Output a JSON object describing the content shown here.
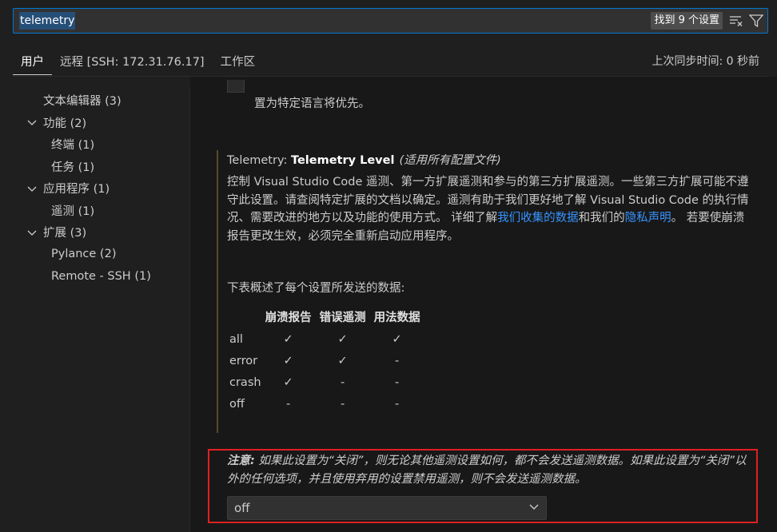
{
  "search": {
    "query": "telemetry",
    "result_count": "找到 9 个设置",
    "icons": [
      "clear-filter-icon",
      "filter-icon"
    ]
  },
  "tabs": [
    {
      "label": "用户",
      "active": true
    },
    {
      "label": "远程 [SSH: 172.31.76.17]",
      "active": false
    },
    {
      "label": "工作区",
      "active": false
    }
  ],
  "sync_status": "上次同步时间: 0 秒前",
  "toc": [
    {
      "label": "文本编辑器 (3)",
      "level": 0,
      "expandable": false
    },
    {
      "label": "功能 (2)",
      "level": 0,
      "expandable": true
    },
    {
      "label": "终端 (1)",
      "level": 1,
      "expandable": false
    },
    {
      "label": "任务 (1)",
      "level": 1,
      "expandable": false
    },
    {
      "label": "应用程序 (1)",
      "level": 0,
      "expandable": true
    },
    {
      "label": "遥测 (1)",
      "level": 1,
      "expandable": false
    },
    {
      "label": "扩展 (3)",
      "level": 0,
      "expandable": true
    },
    {
      "label": "Pylance (2)",
      "level": 1,
      "expandable": false
    },
    {
      "label": "Remote - SSH (1)",
      "level": 1,
      "expandable": false
    }
  ],
  "prev_setting_tail": "置为特定语言将优先。",
  "setting": {
    "category": "Telemetry: ",
    "name": "Telemetry Level",
    "scope": "(适用所有配置文件)",
    "desc_part1": "控制 Visual Studio Code 遥测、第一方扩展遥测和参与的第三方扩展遥测。一些第三方扩展可能不遵守此设置。请查阅特定扩展的文档以确定。遥测有助于我们更好地了解 Visual Studio Code 的执行情况、需要改进的地方以及功能的使用方式。 详细了解",
    "link1": "我们收集的数据",
    "desc_part2": "和我们的",
    "link2": "隐私声明",
    "desc_part3": "。 若要使崩溃报告更改生效，必须完全重新启动应用程序。",
    "overview": "下表概述了每个设置所发送的数据:",
    "table": {
      "headers": [
        "",
        "崩溃报告",
        "错误遥测",
        "用法数据"
      ],
      "rows": [
        [
          "all",
          "✓",
          "✓",
          "✓"
        ],
        [
          "error",
          "✓",
          "✓",
          "-"
        ],
        [
          "crash",
          "✓",
          "-",
          "-"
        ],
        [
          "off",
          "-",
          "-",
          "-"
        ]
      ]
    },
    "note_label": "注意:",
    "note_text": " 如果此设置为“关闭”，则无论其他遥测设置如何，都不会发送遥测数据。如果此设置为“关闭”以外的任何选项，并且使用弃用的设置禁用遥测，则不会发送遥测数据。",
    "value": "off"
  }
}
